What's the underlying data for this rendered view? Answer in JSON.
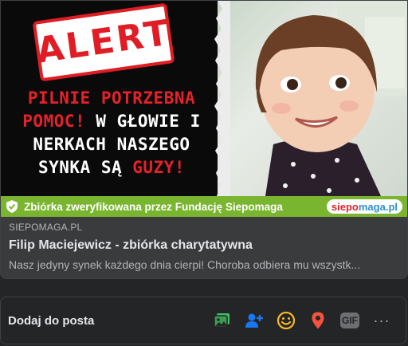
{
  "hero": {
    "alert_text": "ALERT",
    "headline_parts": [
      {
        "text": "PILNIE POTRZEBNA",
        "color": "red"
      },
      {
        "text": "POMOC!",
        "color": "red"
      },
      {
        "text": " W GŁOWIE I",
        "color": "white"
      },
      {
        "text": "NERKACH NASZEGO",
        "color": "white"
      },
      {
        "text": "SYNKA SĄ ",
        "color": "white"
      },
      {
        "text": "GUZY!",
        "color": "red"
      }
    ]
  },
  "verify_bar": {
    "text": "Zbiórka zweryfikowana przez Fundację Siepomaga",
    "brand_part1": "siepo",
    "brand_part2": "maga.pl"
  },
  "link": {
    "domain": "SIEPOMAGA.PL",
    "title": "Filip Maciejewicz - zbiórka charytatywna",
    "description": "Nasz jedyny synek każdego dnia cierpi! Choroba odbiera mu wszystk..."
  },
  "add_to_post": {
    "label": "Dodaj do posta",
    "gif_label": "GIF",
    "more_label": "···"
  },
  "colors": {
    "background": "#242526",
    "accent_red": "#e5222a",
    "verify_green": "#7ab530",
    "photo_icon": "#45bd62",
    "tag_icon": "#1877f2",
    "emoji_icon": "#f7b928",
    "location_icon": "#f5533d"
  },
  "icons": [
    "photo-video-icon",
    "tag-people-icon",
    "feeling-icon",
    "check-in-icon",
    "gif-icon",
    "more-icon"
  ]
}
